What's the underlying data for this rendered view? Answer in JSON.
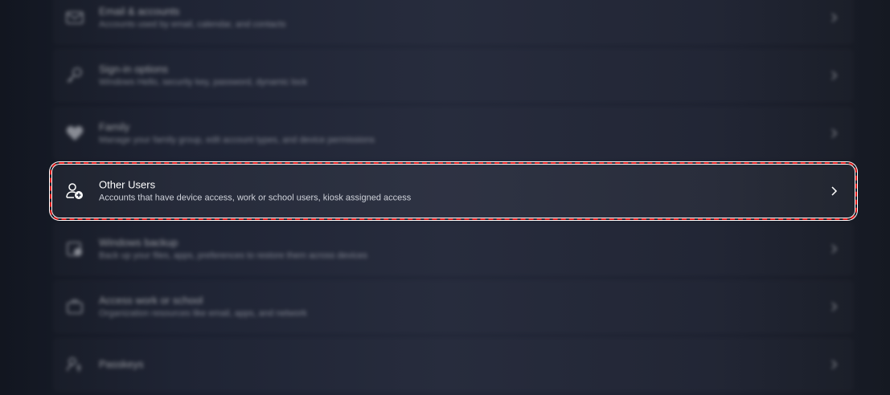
{
  "settings_list": {
    "items": [
      {
        "title": "Email & accounts",
        "description": "Accounts used by email, calendar, and contacts",
        "icon": "mail-icon"
      },
      {
        "title": "Sign-in options",
        "description": "Windows Hello, security key, password, dynamic lock",
        "icon": "key-icon"
      },
      {
        "title": "Family",
        "description": "Manage your family group, edit account types, and device permissions",
        "icon": "heart-icon"
      },
      {
        "title": "Other Users",
        "description": "Accounts that have device access, work or school users, kiosk assigned access",
        "icon": "add-user-icon"
      },
      {
        "title": "Windows backup",
        "description": "Back up your files, apps, preferences to restore them across devices",
        "icon": "backup-icon"
      },
      {
        "title": "Access work or school",
        "description": "Organization resources like email, apps, and network",
        "icon": "briefcase-icon"
      },
      {
        "title": "Passkeys",
        "description": "",
        "icon": "passkey-icon"
      }
    ]
  },
  "colors": {
    "highlight_outline": "#e01818",
    "text_primary": "#ffffff",
    "text_secondary": "#cfd2da"
  }
}
